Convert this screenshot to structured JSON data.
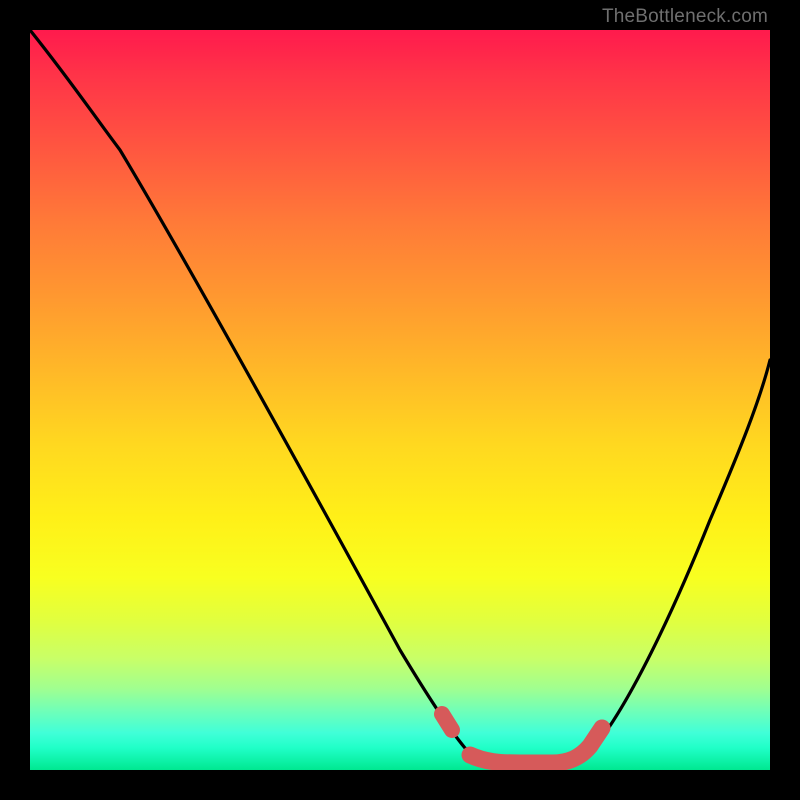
{
  "watermark": "TheBottleneck.com",
  "chart_data": {
    "type": "line",
    "title": "",
    "xlabel": "",
    "ylabel": "",
    "xlim": [
      0,
      100
    ],
    "ylim": [
      0,
      100
    ],
    "grid": false,
    "legend": false,
    "background": "vertical-gradient red→yellow→green (bottleneck heat)",
    "series": [
      {
        "name": "bottleneck-curve",
        "color": "#000000",
        "x": [
          0,
          6,
          12,
          18,
          24,
          30,
          36,
          42,
          48,
          52,
          56,
          58,
          60,
          64,
          68,
          72,
          76,
          80,
          84,
          88,
          92,
          96,
          100
        ],
        "y": [
          100,
          93,
          84,
          75,
          66,
          57,
          48,
          39,
          30,
          22,
          14,
          8,
          4,
          2,
          2,
          2,
          3,
          6,
          12,
          20,
          30,
          42,
          56
        ]
      },
      {
        "name": "optimal-range-highlight",
        "color": "#d65a5a",
        "x": [
          56,
          58,
          60,
          64,
          68,
          72,
          74
        ],
        "y": [
          10,
          6,
          3,
          2,
          2,
          2,
          4
        ]
      }
    ]
  },
  "colors": {
    "frame": "#000000",
    "curve": "#000000",
    "highlight": "#d65a5a",
    "watermark": "#6f6f6f"
  }
}
